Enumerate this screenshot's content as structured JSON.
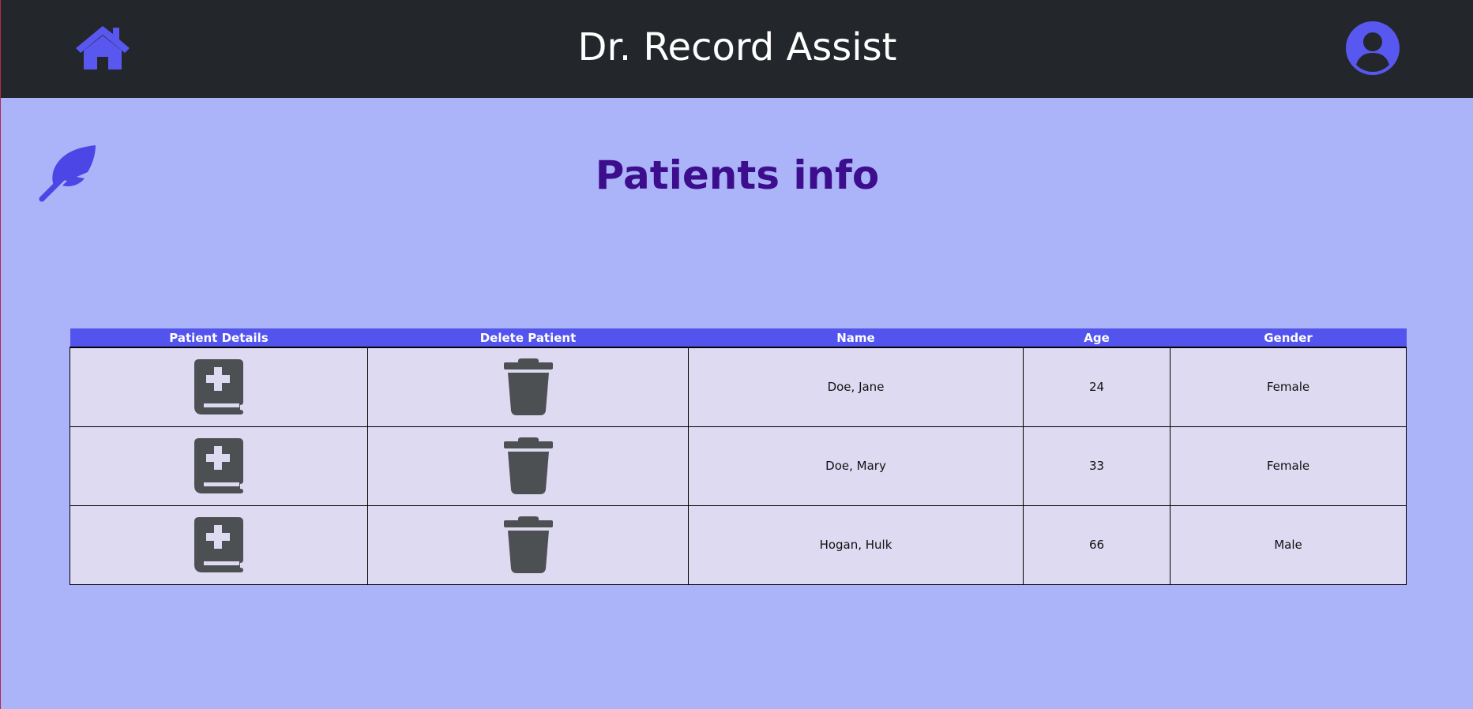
{
  "header": {
    "title": "Dr. Record Assist",
    "home_icon": "home-icon",
    "avatar_icon": "user-avatar-icon"
  },
  "main": {
    "title": "Patients info",
    "decor_icon": "feather-icon"
  },
  "table": {
    "columns": [
      "Patient Details",
      "Delete Patient",
      "Name",
      "Age",
      "Gender"
    ],
    "rows": [
      {
        "name": "Doe, Jane",
        "age": "24",
        "gender": "Female"
      },
      {
        "name": "Doe, Mary",
        "age": "33",
        "gender": "Female"
      },
      {
        "name": "Hogan, Hulk",
        "age": "66",
        "gender": "Male"
      }
    ],
    "details_icon": "medical-book-icon",
    "delete_icon": "trash-icon"
  },
  "colors": {
    "navbar_bg": "#23272b",
    "page_bg": "#abb4f8",
    "accent": "#5353ee",
    "title": "#3c0d8c",
    "cell_bg": "#dedaf2",
    "icon_gray": "#4d5052"
  }
}
